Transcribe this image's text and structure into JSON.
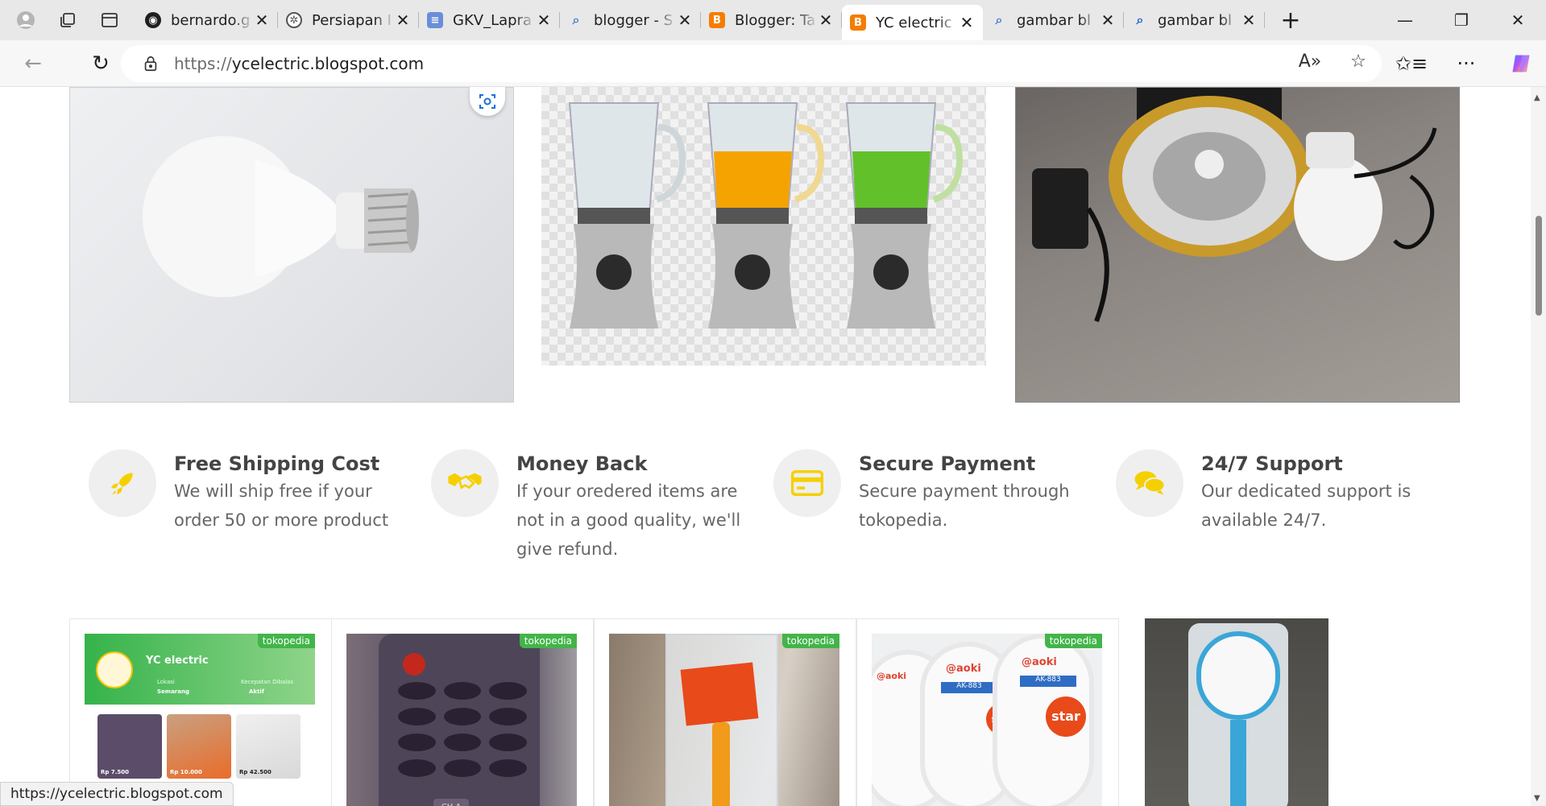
{
  "tabs": [
    {
      "title": "bernardo.g",
      "favicon": "github-icon"
    },
    {
      "title": "Persiapan I",
      "favicon": "chatgpt-icon"
    },
    {
      "title": "GKV_Lapra",
      "favicon": "docs-icon"
    },
    {
      "title": "blogger - S",
      "favicon": "search-icon"
    },
    {
      "title": "Blogger: Ta",
      "favicon": "blogger-icon"
    },
    {
      "title": "YC electric",
      "favicon": "blogger-icon",
      "active": true
    },
    {
      "title": "gambar bl",
      "favicon": "search-icon"
    },
    {
      "title": "gambar bl",
      "favicon": "search-icon"
    }
  ],
  "address": {
    "protocol": "https://",
    "host": "ycelectric.blogspot.com"
  },
  "features": [
    {
      "title": "Free Shipping Cost",
      "desc": "We will ship free if your order 50 or more product",
      "icon": "rocket-icon"
    },
    {
      "title": "Money Back",
      "desc": "If your oredered items are not in a good quality, we'll give refund.",
      "icon": "handshake-icon"
    },
    {
      "title": "Secure Payment",
      "desc": "Secure payment through tokopedia.",
      "icon": "credit-card-icon"
    },
    {
      "title": "24/7 Support",
      "desc": "Our dedicated support is available 24/7.",
      "icon": "chat-bubbles-icon"
    }
  ],
  "products": {
    "badge": "tokopedia",
    "shop_name": "YC electric",
    "shop_location_label": "Lokasi",
    "shop_location": "Semarang",
    "shop_speed_label": "Kecepatan Dibalas",
    "shop_speed": "Aktif",
    "prices": [
      "Rp 7.500",
      "Rp 10.000",
      "Rp 42.500"
    ],
    "remote_label": "CH.A",
    "racket_brand": "@aoki",
    "racket_model": "AK-883",
    "racket_tag": "star"
  },
  "status_url": "https://ycelectric.blogspot.com",
  "colors": {
    "accent": "#f5d000",
    "tokopedia": "#42b549",
    "blogger": "#f57d00"
  }
}
